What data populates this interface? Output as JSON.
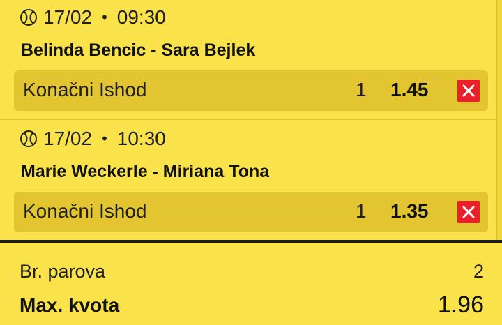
{
  "matches": [
    {
      "date": "17/02",
      "separator": "•",
      "time": "09:30",
      "players": "Belinda Bencic - Sara Bejlek",
      "market": "Konačni Ishod",
      "outcome": "1",
      "odds": "1.45"
    },
    {
      "date": "17/02",
      "separator": "•",
      "time": "10:30",
      "players": "Marie Weckerle - Miriana Tona",
      "market": "Konačni Ishod",
      "outcome": "1",
      "odds": "1.35"
    }
  ],
  "summary": {
    "pairs_label": "Br. parova",
    "pairs_value": "2",
    "max_odds_label": "Max. kvota",
    "max_odds_value": "1.96"
  },
  "icons": {
    "sport": "tennis-ball-icon",
    "remove": "close-icon"
  },
  "colors": {
    "background": "#f9e24a",
    "bet_row": "#e2c530",
    "remove_button": "#e8202a"
  }
}
